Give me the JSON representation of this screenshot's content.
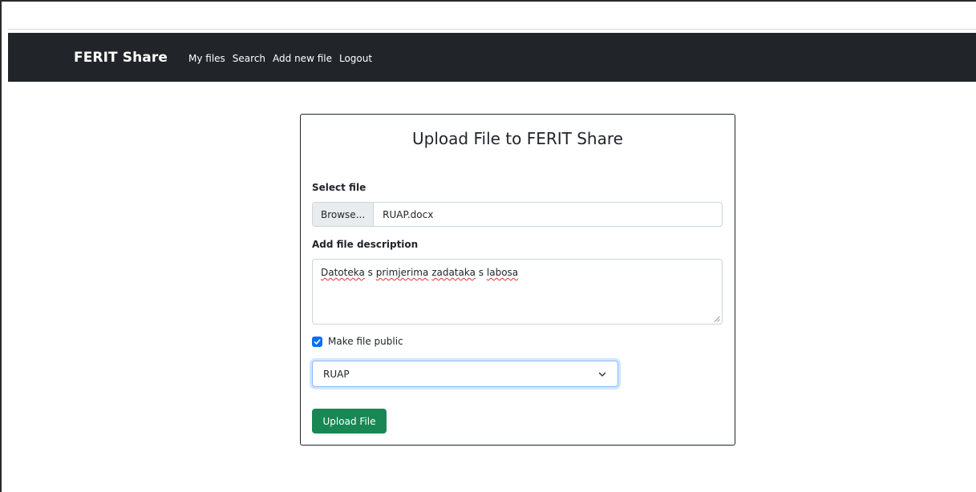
{
  "navbar": {
    "brand": "FERIT Share",
    "links": [
      "My files",
      "Search",
      "Add new file",
      "Logout"
    ]
  },
  "form": {
    "title": "Upload File to FERIT Share",
    "file_label": "Select file",
    "browse_label": "Browse...",
    "file_name": "RUAP.docx",
    "description_label": "Add file description",
    "description_words": [
      "Datoteka",
      "s",
      "primjerima",
      "zadataka",
      "s",
      "labosa"
    ],
    "public_label": "Make file public",
    "public_checked": true,
    "subject_selected": "RUAP",
    "submit_label": "Upload File"
  },
  "colors": {
    "navbar_bg": "#212529",
    "checkbox": "#0d6efd",
    "submit": "#198754"
  },
  "icons": {
    "checkbox": "check-icon",
    "select": "chevron-down-icon",
    "textarea": "resize-handle-icon"
  }
}
